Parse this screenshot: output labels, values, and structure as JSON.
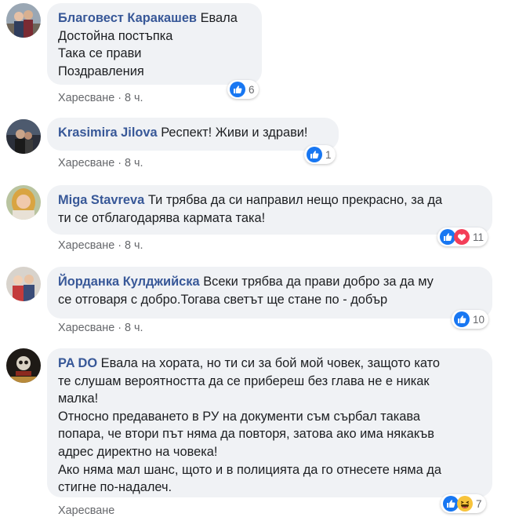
{
  "comments": [
    {
      "name": "Благовест Каракашев",
      "first_line": "Евала",
      "rest": "Достойна постъпка\nТака се прави\nПоздравления",
      "action": "Харесване",
      "time": "8 ч.",
      "reactions": [
        "like-icon"
      ],
      "count": "6"
    },
    {
      "name": "Krasimira Jilova",
      "first_line": "Респект! Живи и здрави!",
      "rest": "",
      "action": "Харесване",
      "time": "8 ч.",
      "reactions": [
        "like-icon"
      ],
      "count": "1"
    },
    {
      "name": "Miga Stavreva",
      "first_line": "Ти трябва да си направил нещо прекрасно, за да",
      "rest": "ти се отблагодарява кармата така!",
      "action": "Харесване",
      "time": "8 ч.",
      "reactions": [
        "like-icon",
        "heart-icon"
      ],
      "count": "11"
    },
    {
      "name": "Йорданка Кулджийска",
      "first_line": "Всеки трябва да прави добро за да му",
      "rest": "се отговаря с добро.Тогава светът ще стане по - добър",
      "action": "Харесване",
      "time": "8 ч.",
      "reactions": [
        "like-icon"
      ],
      "count": "10"
    },
    {
      "name": "PA DO",
      "first_line": "Евала на хората, но ти си за бой мой човек, защото като",
      "rest": "те слушам вероятността да се прибереш без глава не е никак\nмалка!\nОтносно предаването в РУ на документи съм сърбал такава\nпопара, че втори път няма да повторя, затова ако има някакъв\nадрес директно на човека!\nАко няма мал шанс, щото и в полицията да го отнесете няма да\nстигне по-надалеч.",
      "action": "Харесване",
      "time": "",
      "reactions": [
        "like-icon",
        "haha-icon"
      ],
      "count": "7"
    }
  ]
}
